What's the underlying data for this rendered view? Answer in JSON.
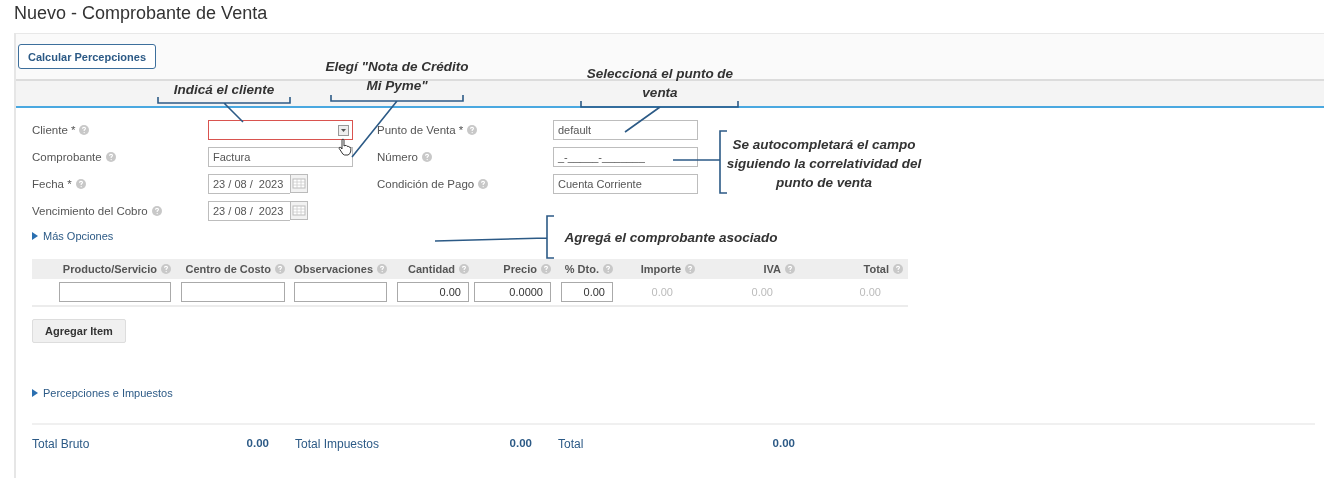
{
  "page_title": "Nuevo - Comprobante de Venta",
  "toolbar": {
    "buttons": [
      "Calcular Percepciones"
    ]
  },
  "form": {
    "left": [
      {
        "label": "Cliente *",
        "kind": "select",
        "invalid": true
      },
      {
        "label": "Comprobante",
        "kind": "text",
        "value": "Factura",
        "invalid": false
      },
      {
        "label": "Fecha *",
        "kind": "date",
        "value": "23 / 08 /  2023",
        "invalid": false
      },
      {
        "label": "Vencimiento del Cobro",
        "kind": "date",
        "value": "23 / 08 /  2023",
        "invalid": false
      }
    ],
    "right": [
      {
        "label": "Punto de Venta *",
        "kind": "text",
        "value": "default",
        "invalid": false
      },
      {
        "label": "Número",
        "kind": "text",
        "value": "_-_____-_______",
        "invalid": false
      },
      {
        "label": "Condición de Pago",
        "kind": "text",
        "value": "Cuenta Corriente",
        "invalid": false
      }
    ]
  },
  "more_options": {
    "label": "Más Opciones",
    "expanded": false
  },
  "items_table": {
    "columns": [
      "Producto/Servicio",
      "Centro de Costo",
      "Observaciones",
      "Cantidad",
      "Precio",
      "% Dto.",
      "Importe",
      "IVA",
      "Total"
    ],
    "rows": [
      [
        {
          "kind": "input"
        },
        {
          "kind": "input"
        },
        {
          "kind": "input"
        },
        {
          "kind": "input",
          "value": "0.00"
        },
        {
          "kind": "input",
          "value": "0.0000"
        },
        {
          "kind": "input",
          "value": "0.00"
        },
        {
          "kind": "text",
          "value": "0.00"
        },
        {
          "kind": "text",
          "value": "0.00"
        },
        {
          "kind": "text",
          "value": "0.00"
        }
      ]
    ]
  },
  "add_item_button": "Agregar Item",
  "taxes_section": {
    "label": "Percepciones e Impuestos",
    "expanded": false
  },
  "totals": [
    {
      "label": "Total Bruto",
      "value": "0.00"
    },
    {
      "label": "Total Impuestos",
      "value": "0.00"
    },
    {
      "label": "Total",
      "value": "0.00"
    }
  ],
  "annotations": [
    {
      "text": "Indicá el cliente"
    },
    {
      "text": "Elegí \"Nota de Crédito Mi Pyme\""
    },
    {
      "text": "Seleccioná el punto de venta"
    },
    {
      "text": "Se autocompletará el campo siguiendo la correlatividad del punto de venta"
    },
    {
      "text": "Agregá el comprobante asociado"
    }
  ]
}
